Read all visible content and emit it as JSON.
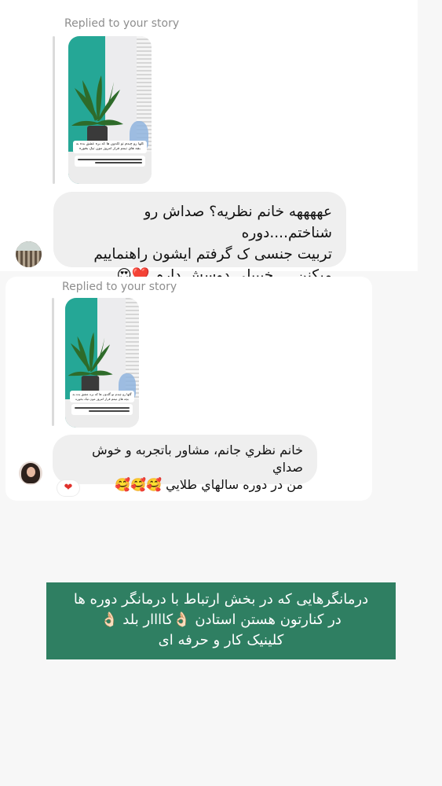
{
  "thread": {
    "first": {
      "reply_label": "Replied to your story",
      "story_caption": {
        "line1": "گلها رو چیدم تو گلدون ها که بره عشق بده به",
        "line2": "بچه های تیمم قرار امروز مون تیک بخوره"
      },
      "message_lines": [
        "عههههه خانم نظریه؟ صداش رو شناختم....دوره",
        "تربیت جنسی ک گرفتم ایشون راهنماییم",
        "میکنن.....خیییلی دوسش دارم ❤️😍"
      ]
    },
    "second": {
      "reply_label": "Replied to your story",
      "story_caption": {
        "line1": "گلها رو چیدم تو گلدون ها که بره عشق بده به",
        "line2": "بچه های تیمم قرار امروز مون تیک بخوره"
      },
      "message_lines": [
        "خانم نظري جانم، مشاور باتجربه و خوش صداي",
        "من در دوره سالهاي طلايي 🥰🥰🥰"
      ],
      "reaction": "❤"
    }
  },
  "banner": {
    "lines": [
      "درمانگرهایی که در بخش ارتباط با درمانگر دوره ها",
      "در کنارتون هستن استادن 👌🏻کاااار بلد 👌🏻",
      "کلینیک کار و حرفه ای"
    ],
    "background": "#2f7f62"
  }
}
